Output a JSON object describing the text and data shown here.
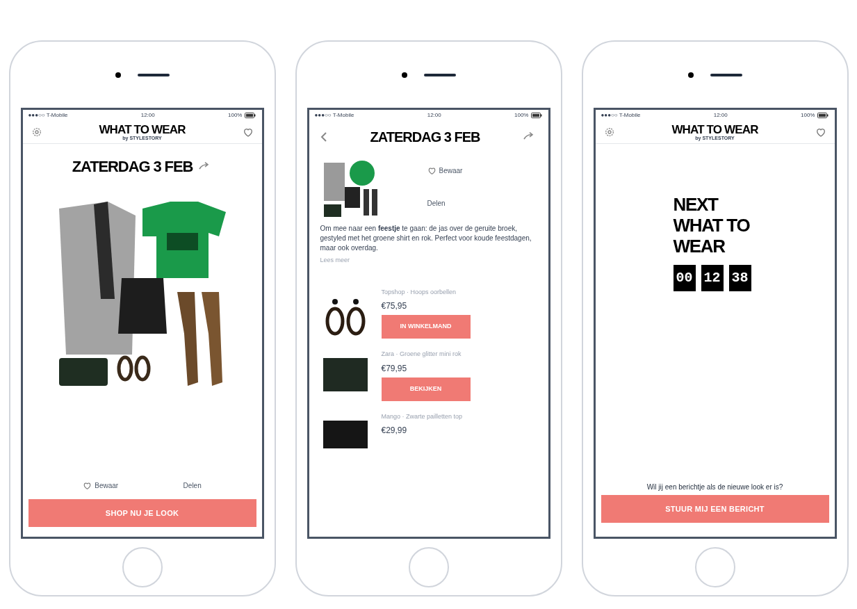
{
  "phones": [
    {
      "kind": "outfit",
      "status_bar": {
        "carrier": "●●●○○ T-Mobile",
        "time": "12:00",
        "battery": "100%"
      },
      "header": {
        "title": "WHAT TO WEAR",
        "subtitle": "by STYLESTORY"
      },
      "date": "ZATERDAG 3 FEB",
      "actions": {
        "save": "Bewaar",
        "share": "Delen"
      },
      "button": "SHOP NU JE LOOK"
    },
    {
      "kind": "detail",
      "status_bar": {
        "carrier": "●●●○○ T-Mobile",
        "time": "12:00",
        "battery": "100%"
      },
      "date": "ZATERDAG 3 FEB",
      "actions": {
        "save": "Bewaar",
        "share": "Delen"
      },
      "description": "Om mee naar een **feestje** te gaan: de jas over de geruite broek, gestyled met het groene shirt en rok. Perfect voor koude feestdagen, maar ook overdag.",
      "read_more": "Lees meer",
      "products": [
        {
          "brand": "Topshop · Hoops oorbellen",
          "price": "€75,95",
          "button": "IN WINKELMAND",
          "kind": "earrings"
        },
        {
          "brand": "Zara · Groene glitter mini rok",
          "price": "€79,95",
          "button": "BEKIJKEN",
          "kind": "skirt"
        },
        {
          "brand": "Mango · Zwarte pailletten top",
          "price": "€29,99",
          "kind": "top"
        }
      ]
    },
    {
      "kind": "countdown",
      "status_bar": {
        "carrier": "●●●○○ T-Mobile",
        "time": "12:00",
        "battery": "100%"
      },
      "header": {
        "title": "WHAT TO WEAR",
        "subtitle": "by STYLESTORY"
      },
      "next_lines": [
        "NEXT",
        "WHAT TO",
        "WEAR"
      ],
      "timer": [
        "00",
        "12",
        "38"
      ],
      "question": "Wil jij een berichtje als de nieuwe look er is?",
      "button": "STUUR MIJ EEN BERICHT"
    }
  ]
}
